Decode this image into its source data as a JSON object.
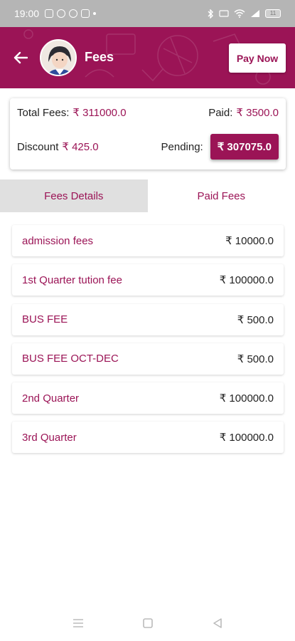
{
  "status": {
    "time": "19:00",
    "battery": "11"
  },
  "header": {
    "title": "Fees",
    "pay_now": "Pay Now"
  },
  "summary": {
    "total_label": "Total Fees:",
    "total_value": "₹ 311000.0",
    "paid_label": "Paid:",
    "paid_value": "₹ 3500.0",
    "discount_label": "Discount",
    "discount_value": "₹ 425.0",
    "pending_label": "Pending:",
    "pending_value": "₹ 307075.0"
  },
  "tabs": [
    {
      "label": "Fees Details",
      "active": true
    },
    {
      "label": "Paid Fees",
      "active": false
    }
  ],
  "fees": [
    {
      "name": "admission fees",
      "amount": "₹ 10000.0"
    },
    {
      "name": "1st Quarter tution fee",
      "amount": "₹ 100000.0"
    },
    {
      "name": "BUS FEE",
      "amount": "₹ 500.0"
    },
    {
      "name": "BUS FEE OCT-DEC",
      "amount": "₹ 500.0"
    },
    {
      "name": "2nd Quarter",
      "amount": "₹ 100000.0"
    },
    {
      "name": "3rd Quarter",
      "amount": "₹ 100000.0"
    }
  ],
  "colors": {
    "brand": "#9b1456",
    "tab_active_bg": "#e0e0e0"
  },
  "icons": {
    "back": "arrow-left-icon",
    "nav_menu": "menu-icon",
    "nav_home": "square-home-icon",
    "nav_back": "triangle-back-icon"
  }
}
